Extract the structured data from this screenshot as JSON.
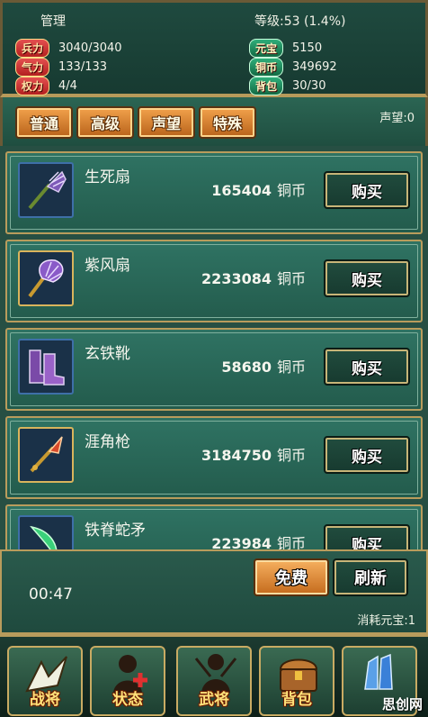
{
  "header": {
    "name": "管理",
    "level": "等级:53 (1.4%)",
    "stats_left": [
      {
        "label": "兵力",
        "value": "3040/3040"
      },
      {
        "label": "气力",
        "value": "133/133"
      },
      {
        "label": "权力",
        "value": "4/4"
      }
    ],
    "stats_right": [
      {
        "label": "元宝",
        "value": "5150"
      },
      {
        "label": "铜币",
        "value": "349692"
      },
      {
        "label": "背包",
        "value": "30/30"
      }
    ]
  },
  "tabs": [
    {
      "label": "普通"
    },
    {
      "label": "高级"
    },
    {
      "label": "声望"
    },
    {
      "label": "特殊"
    }
  ],
  "reputation": "声望:0",
  "currency_unit": "铜币",
  "buy_label": "购买",
  "items": [
    {
      "name": "生死扇",
      "price": "165404",
      "icon": "fan-icon",
      "frame": "#3e6fa8"
    },
    {
      "name": "紫风扇",
      "price": "2233084",
      "icon": "fan-icon",
      "frame": "#d9b45c"
    },
    {
      "name": "玄铁靴",
      "price": "58680",
      "icon": "boots-icon",
      "frame": "#3e6fa8"
    },
    {
      "name": "涯角枪",
      "price": "3184750",
      "icon": "spear-icon",
      "frame": "#d9b45c"
    },
    {
      "name": "铁脊蛇矛",
      "price": "223984",
      "icon": "blade-icon",
      "frame": "#3e6fa8"
    }
  ],
  "footer": {
    "timer": "00:47",
    "free_label": "免费",
    "refresh_label": "刷新",
    "cost": "消耗元宝:1"
  },
  "nav": [
    {
      "label": "战将",
      "icon": "warrior-icon"
    },
    {
      "label": "状态",
      "icon": "status-icon"
    },
    {
      "label": "武将",
      "icon": "general-icon"
    },
    {
      "label": "背包",
      "icon": "chest-icon"
    },
    {
      "label": "",
      "icon": "crystal-icon"
    }
  ],
  "watermark": "思创网"
}
